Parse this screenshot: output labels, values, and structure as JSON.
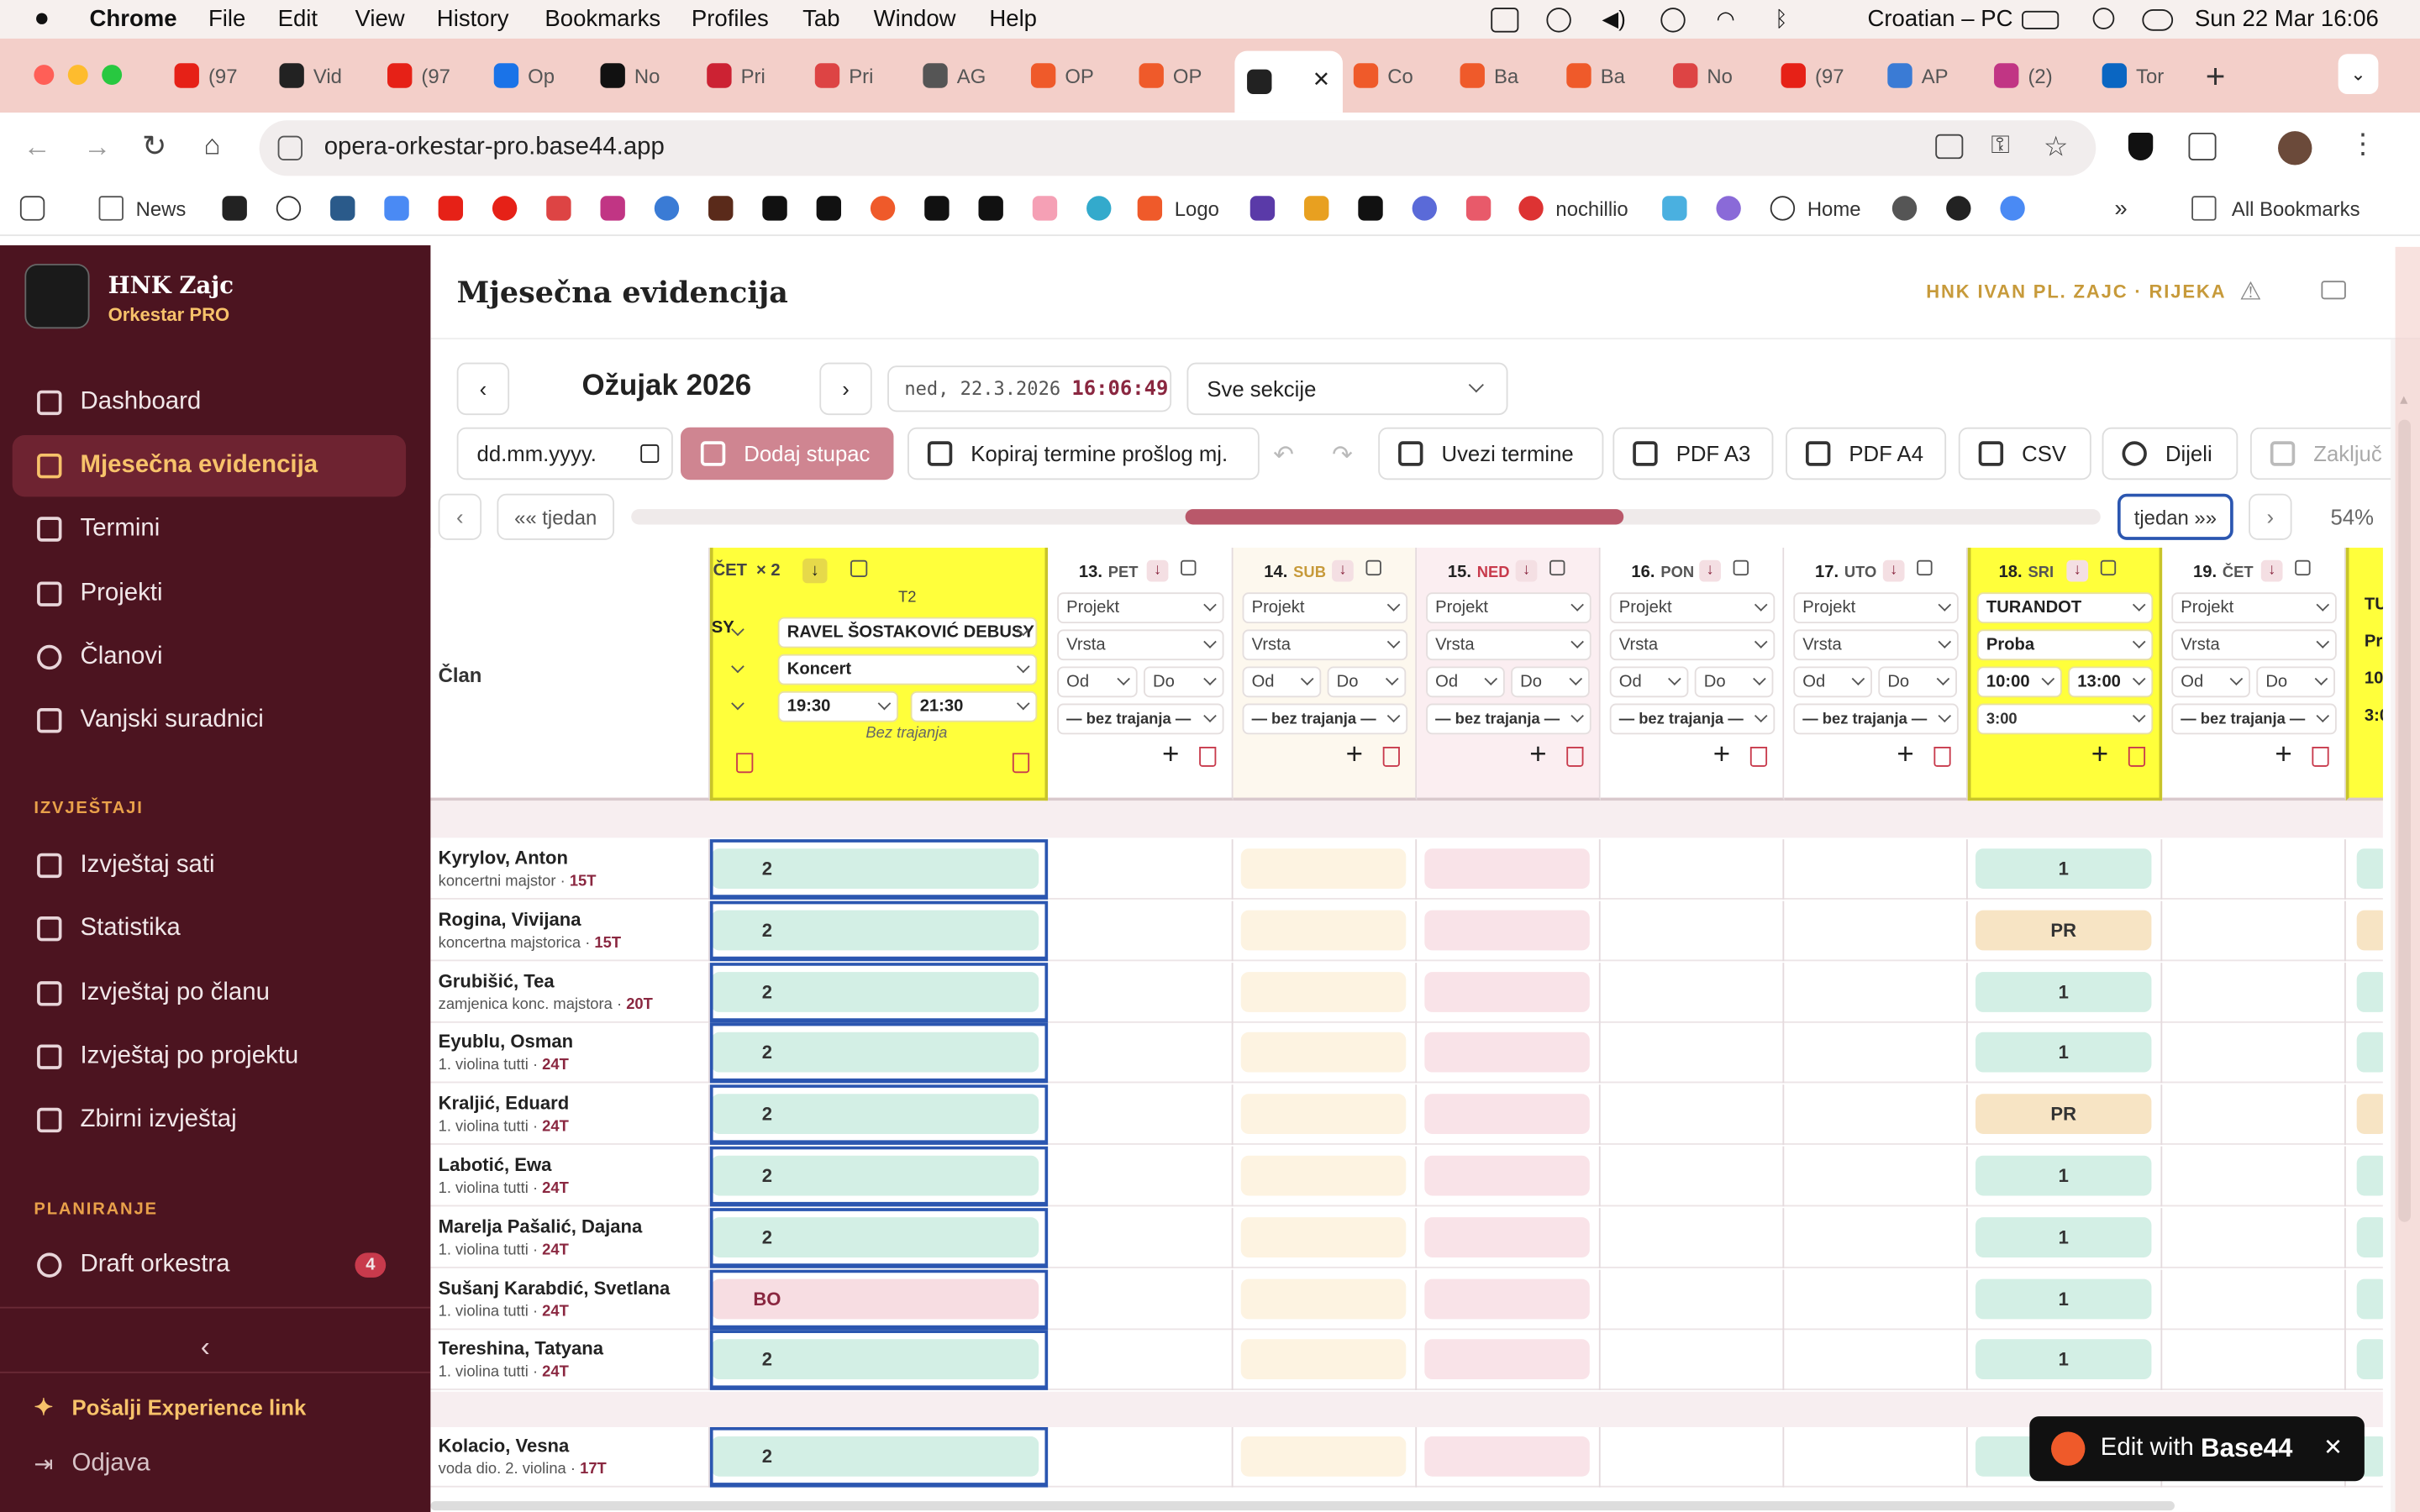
{
  "menubar": {
    "app": "Chrome",
    "menus": [
      "File",
      "Edit",
      "View",
      "History",
      "Bookmarks",
      "Profiles",
      "Tab",
      "Window",
      "Help"
    ],
    "keyboard": "Croatian – PC",
    "datetime": "Sun 22 Mar  16:06"
  },
  "tabs": [
    {
      "label": "(97",
      "color": "#e62117"
    },
    {
      "label": "Vid",
      "color": "#222"
    },
    {
      "label": "(97",
      "color": "#e62117"
    },
    {
      "label": "Op",
      "color": "#1a73e8"
    },
    {
      "label": "No",
      "color": "#111"
    },
    {
      "label": "Pri",
      "color": "#c23"
    },
    {
      "label": "Pri",
      "color": "#d44"
    },
    {
      "label": "AG",
      "color": "#555"
    },
    {
      "label": "OP",
      "color": "#ef5a2a"
    },
    {
      "label": "OP",
      "color": "#ef5a2a"
    },
    {
      "label": "",
      "color": "#222"
    },
    {
      "label": "Co",
      "color": "#ef5a2a"
    },
    {
      "label": "Ba",
      "color": "#ef5a2a"
    },
    {
      "label": "Ba",
      "color": "#ef5a2a"
    },
    {
      "label": "No",
      "color": "#d44"
    },
    {
      "label": "(97",
      "color": "#e62117"
    },
    {
      "label": "AP",
      "color": "#3a7bd5"
    },
    {
      "label": "(2)",
      "color": "#c13584"
    },
    {
      "label": "Tor",
      "color": "#0a66c2"
    }
  ],
  "address": {
    "url": "opera-orkestar-pro.base44.app"
  },
  "bookmarks": {
    "news": "News",
    "logo": "Logo",
    "nochillio": "nochillio",
    "home": "Home",
    "all": "All Bookmarks"
  },
  "sidebar": {
    "org": "HNK Zajc",
    "product": "Orkestar PRO",
    "items": [
      "Dashboard",
      "Mjesečna evidencija",
      "Termini",
      "Projekti",
      "Članovi",
      "Vanjski suradnici"
    ],
    "reports_title": "IZVJEŠTAJI",
    "reports": [
      "Izvještaj sati",
      "Statistika",
      "Izvještaj po članu",
      "Izvještaj po projektu",
      "Zbirni izvještaj"
    ],
    "planning_title": "PLANIRANJE",
    "draft": "Draft orkestra",
    "draft_badge": "4",
    "experience": "Pošalji Experience link",
    "logout": "Odjava"
  },
  "header": {
    "title": "Mjesečna evidencija",
    "org_label": "HNK IVAN PL. ZAJC · RIJEKA"
  },
  "toolbar": {
    "month": "Ožujak 2026",
    "datetime_prefix": "ned, 22.3.2026",
    "datetime_time": "16:06:49",
    "section_select": "Sve sekcije",
    "date_input_placeholder": "dd.mm.yyyy.",
    "add_column": "Dodaj stupac",
    "copy_terms": "Kopiraj termine prošlog mj.",
    "import_terms": "Uvezi termine",
    "pdf_a3": "PDF A3",
    "pdf_a4": "PDF A4",
    "csv": "CSV",
    "share": "Dijeli",
    "lock": "Zaključ",
    "prev_week": "«« tjedan",
    "next_week": "tjedan »»",
    "zoom": "54%"
  },
  "grid": {
    "member_header": "Član",
    "first_col": {
      "day": "ČET",
      "multiplier": "× 2",
      "t2": "T2",
      "partial_project": "SY",
      "project": "RAVEL ŠOSTAKOVIĆ DEBUSY",
      "type": "Koncert",
      "from": "19:30",
      "to": "21:30",
      "duration": "Bez trajanja"
    },
    "days": [
      {
        "num": "13.",
        "name": "PET",
        "project": "Projekt",
        "type": "Vrsta",
        "from": "Od",
        "to": "Do",
        "duration": "— bez trajanja —",
        "kind": "plain"
      },
      {
        "num": "14.",
        "name": "SUB",
        "project": "Projekt",
        "type": "Vrsta",
        "from": "Od",
        "to": "Do",
        "duration": "— bez trajanja —",
        "kind": "sat"
      },
      {
        "num": "15.",
        "name": "NED",
        "project": "Projekt",
        "type": "Vrsta",
        "from": "Od",
        "to": "Do",
        "duration": "— bez trajanja —",
        "kind": "sun"
      },
      {
        "num": "16.",
        "name": "PON",
        "project": "Projekt",
        "type": "Vrsta",
        "from": "Od",
        "to": "Do",
        "duration": "— bez trajanja —",
        "kind": "plain"
      },
      {
        "num": "17.",
        "name": "UTO",
        "project": "Projekt",
        "type": "Vrsta",
        "from": "Od",
        "to": "Do",
        "duration": "— bez trajanja —",
        "kind": "plain"
      },
      {
        "num": "18.",
        "name": "SRI",
        "project": "TURANDOT",
        "type": "Proba",
        "from": "10:00",
        "to": "13:00",
        "duration": "3:00",
        "kind": "event"
      },
      {
        "num": "19.",
        "name": "ČET",
        "project": "Projekt",
        "type": "Vrsta",
        "from": "Od",
        "to": "Do",
        "duration": "— bez trajanja —",
        "kind": "plain"
      }
    ],
    "partial_last": {
      "project": "TU",
      "type": "Pr",
      "from": "10",
      "duration": "3:0"
    },
    "members": [
      {
        "name": "Kyrylov, Anton",
        "role": "koncertni majstor",
        "tag": "15T",
        "first": "2",
        "d18": "1",
        "d18kind": "green"
      },
      {
        "name": "Rogina, Vivijana",
        "role": "koncertna majstorica",
        "tag": "15T",
        "first": "2",
        "d18": "PR",
        "d18kind": "tan"
      },
      {
        "name": "Grubišić, Tea",
        "role": "zamjenica konc. majstora",
        "tag": "20T",
        "first": "2",
        "d18": "1",
        "d18kind": "green"
      },
      {
        "name": "Eyublu, Osman",
        "role": "1. violina tutti",
        "tag": "24T",
        "first": "2",
        "d18": "1",
        "d18kind": "green"
      },
      {
        "name": "Kraljić, Eduard",
        "role": "1. violina tutti",
        "tag": "24T",
        "first": "2",
        "d18": "PR",
        "d18kind": "tan"
      },
      {
        "name": "Labotić, Ewa",
        "role": "1. violina tutti",
        "tag": "24T",
        "first": "2",
        "d18": "1",
        "d18kind": "green"
      },
      {
        "name": "Marelja Pašalić, Dajana",
        "role": "1. violina tutti",
        "tag": "24T",
        "first": "2",
        "d18": "1",
        "d18kind": "green"
      },
      {
        "name": "Sušanj Karabdić, Svetlana",
        "role": "1. violina tutti",
        "tag": "24T",
        "first": "BO",
        "d18": "1",
        "d18kind": "green"
      },
      {
        "name": "Tereshina, Tatyana",
        "role": "1. violina tutti",
        "tag": "24T",
        "first": "2",
        "d18": "1",
        "d18kind": "green"
      },
      {
        "name": "Kolacio, Vesna",
        "role": "voda dio. 2. violina",
        "tag": "17T",
        "first": "2",
        "d18": "",
        "d18kind": "green"
      }
    ]
  },
  "badge": {
    "text": "Edit with",
    "brand": "Base44"
  },
  "colors": {
    "sidebar": "#4c1420",
    "accent": "#8a2740",
    "highlight": "#ffff3b",
    "green_cell": "#d3efe5",
    "tan_cell": "#f7e4c4",
    "pink_cell": "#f7dde2"
  }
}
